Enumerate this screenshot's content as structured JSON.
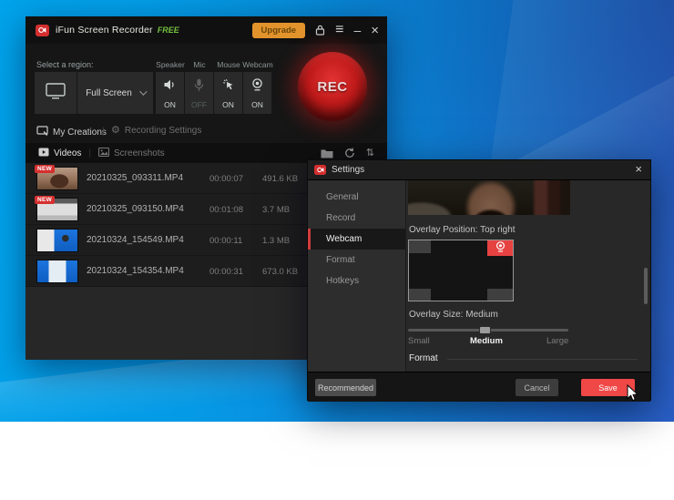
{
  "main_window": {
    "title": "iFun Screen Recorder",
    "edition_badge": "FREE",
    "upgrade_label": "Upgrade",
    "region_label": "Select a region:",
    "region_value": "Full Screen",
    "toggles": [
      {
        "label": "Speaker",
        "state": "ON"
      },
      {
        "label": "Mic",
        "state": "OFF"
      },
      {
        "label": "Mouse",
        "state": "ON"
      },
      {
        "label": "Webcam",
        "state": "ON"
      }
    ],
    "rec_label": "REC",
    "nav_my_creations": "My Creations",
    "nav_recording_settings": "Recording Settings",
    "nav_separator": "|",
    "tab_videos": "Videos",
    "tab_screenshots": "Screenshots",
    "tab_separator": "|",
    "new_badge": "NEW",
    "videos": [
      {
        "name": "20210325_093311.MP4",
        "duration": "00:00:07",
        "size": "491.6 KB"
      },
      {
        "name": "20210325_093150.MP4",
        "duration": "00:01:08",
        "size": "3.7 MB"
      },
      {
        "name": "20210324_154549.MP4",
        "duration": "00:00:11",
        "size": "1.3 MB"
      },
      {
        "name": "20210324_154354.MP4",
        "duration": "00:00:31",
        "size": "673.0 KB"
      }
    ]
  },
  "settings": {
    "title": "Settings",
    "sidebar": [
      {
        "label": "General"
      },
      {
        "label": "Record"
      },
      {
        "label": "Webcam"
      },
      {
        "label": "Format"
      },
      {
        "label": "Hotkeys"
      }
    ],
    "overlay_position_label": "Overlay Position: Top right",
    "overlay_size_label": "Overlay Size: Medium",
    "size_small": "Small",
    "size_medium": "Medium",
    "size_large": "Large",
    "format_header": "Format",
    "recommended_label": "Recommended",
    "cancel_label": "Cancel",
    "save_label": "Save"
  },
  "icons": {
    "hamburger": "≡",
    "minimize": "–",
    "close": "×",
    "gear": "⚙",
    "sort": "⇅"
  },
  "colors": {
    "accent_red": "#d32f2f",
    "save_red": "#f04747",
    "upgrade_orange": "#e2932c",
    "free_green": "#74c03f",
    "desktop_blue_left": "#01a3eb",
    "desktop_blue_right": "#2a5ec6"
  }
}
